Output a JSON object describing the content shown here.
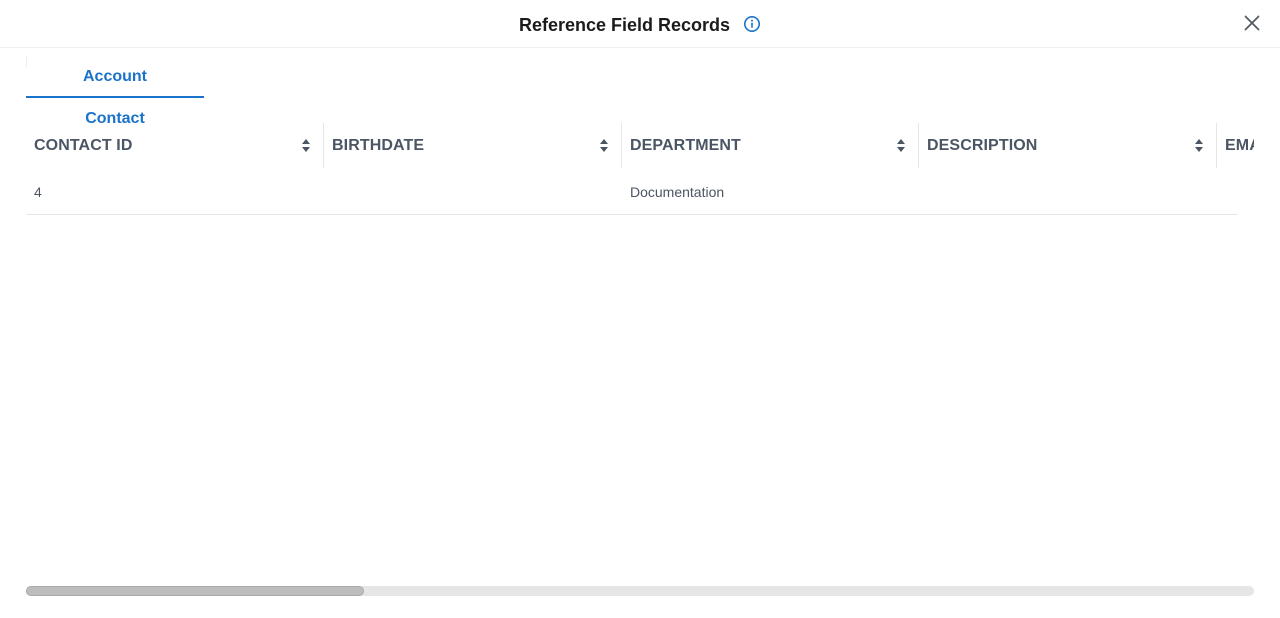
{
  "dialog": {
    "title": "Reference Field Records",
    "info_icon": "info-circle-icon",
    "close_icon": "close-icon"
  },
  "tabs": [
    {
      "label": "Account Contact",
      "active": true
    }
  ],
  "table": {
    "columns": [
      "CONTACT ID",
      "BIRTHDATE",
      "DEPARTMENT",
      "DESCRIPTION",
      "EMA"
    ],
    "rows": [
      [
        "4",
        "",
        "Documentation",
        "",
        ""
      ]
    ]
  },
  "scrollbar": {
    "thumb_fraction": 0.275,
    "position_fraction": 0
  },
  "colors": {
    "accent": "#1a73c8",
    "header_text": "#4b5563",
    "title_text": "#1b1b1b"
  }
}
